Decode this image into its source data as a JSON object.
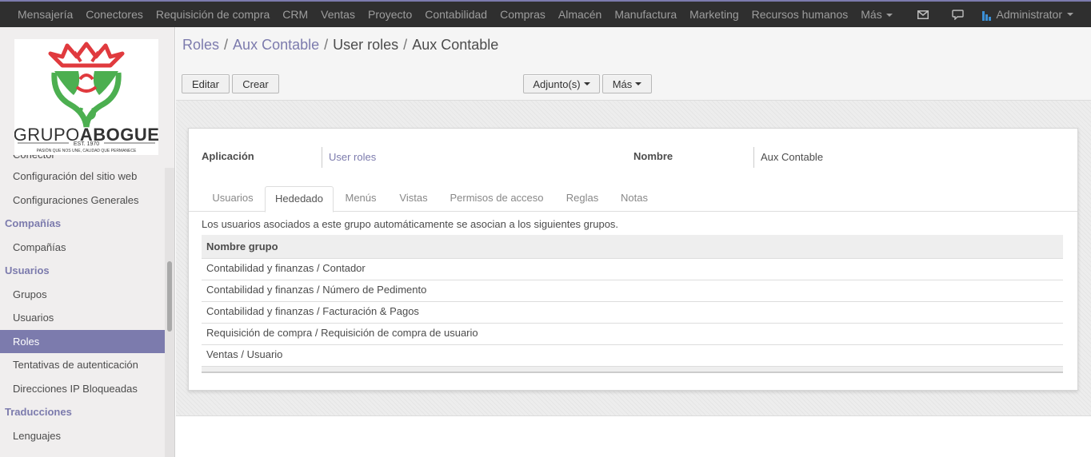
{
  "topbar": {
    "apps": [
      "Mensajería",
      "Conectores",
      "Requisición de compra",
      "CRM",
      "Ventas",
      "Proyecto",
      "Contabilidad",
      "Compras",
      "Almacén",
      "Manufactura",
      "Marketing",
      "Recursos humanos"
    ],
    "more_label": "Más",
    "user_name": "Administrator",
    "icons": [
      "envelope-icon",
      "chat-icon",
      "user-avatar-icon"
    ]
  },
  "sidebar": {
    "logo": {
      "brand": "GRUPO ABOGUE",
      "brand_part1": "GRUPO",
      "brand_part2": "ABOGUE",
      "established": "EST. 1970",
      "tagline": "PASIÓN QUE NOS UNE, CALIDAD QUE PERMANECE"
    },
    "cut_item": "Conector",
    "items_settings": [
      "Configuración del sitio web",
      "Configuraciones Generales"
    ],
    "companies_header": "Compañías",
    "companies_items": [
      "Compañías"
    ],
    "users_header": "Usuarios",
    "users_items": [
      "Grupos",
      "Usuarios",
      "Roles",
      "Tentativas de autenticación",
      "Direcciones IP Bloqueadas"
    ],
    "translations_header": "Traducciones",
    "translations_items": [
      "Lenguajes"
    ],
    "active_item": "Roles"
  },
  "breadcrumb": {
    "roles": "Roles",
    "aux": "Aux Contable",
    "user_roles": "User roles",
    "current": "Aux Contable",
    "separator": "/"
  },
  "toolbar": {
    "edit_label": "Editar",
    "create_label": "Crear",
    "attachments_label": "Adjunto(s)",
    "more_label": "Más"
  },
  "form": {
    "application_label": "Aplicación",
    "application_value": "User roles",
    "name_label": "Nombre",
    "name_value": "Aux Contable",
    "tabs": [
      "Usuarios",
      "Hededado",
      "Menús",
      "Vistas",
      "Permisos de acceso",
      "Reglas",
      "Notas"
    ],
    "active_tab": "Hededado",
    "help_text": "Los usuarios asociados a este grupo automáticamente se asocian a los siguientes grupos.",
    "grid_header": "Nombre grupo",
    "grid_rows": [
      "Contabilidad y finanzas / Contador",
      "Contabilidad y finanzas / Número de Pedimento",
      "Contabilidad y finanzas / Facturación & Pagos",
      "Requisición de compra / Requisición de compra de usuario",
      "Ventas / Usuario"
    ]
  },
  "colors": {
    "brand": "#7c7bad",
    "navbar": "#2f2f2f",
    "logo_red": "#e03a3e",
    "logo_green": "#4caf50"
  }
}
